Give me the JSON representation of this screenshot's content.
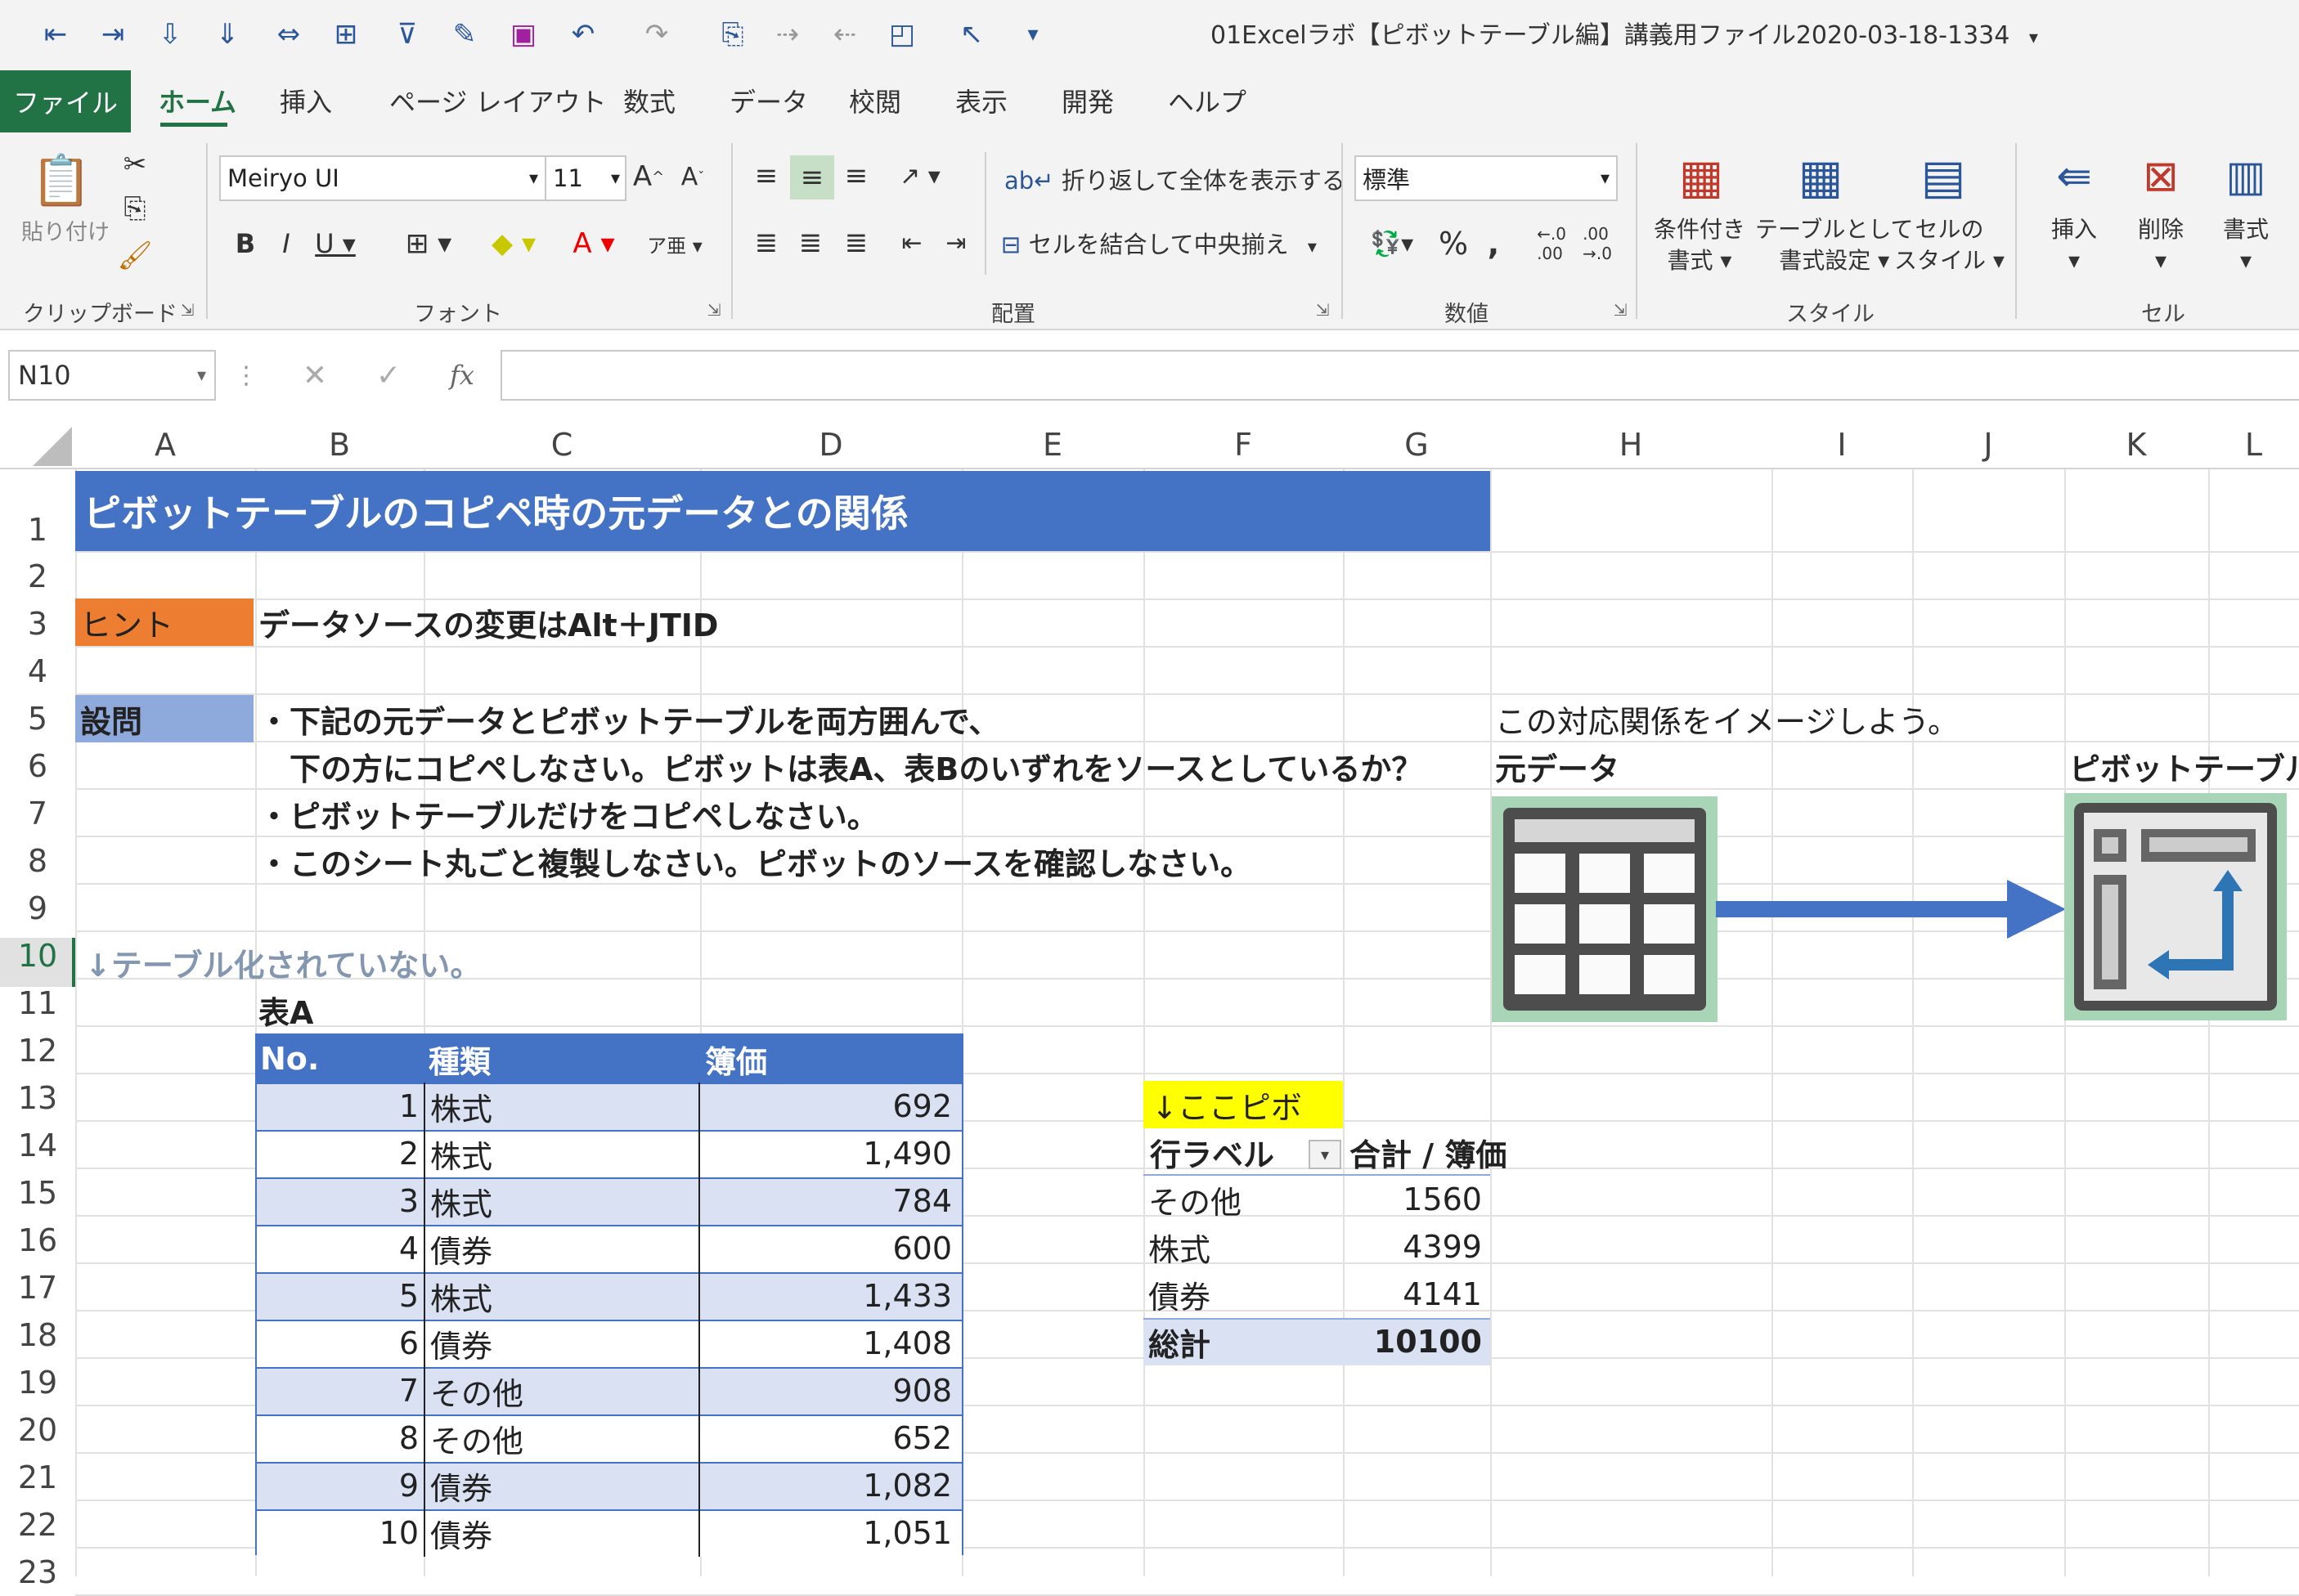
{
  "window": {
    "title": "01Excelラボ【ピボットテーブル編】講義用ファイル2020-03-18-1334",
    "title_dropdown": "▾"
  },
  "ribbon": {
    "tabs": [
      "ファイル",
      "ホーム",
      "挿入",
      "ページ レイアウト",
      "数式",
      "データ",
      "校閲",
      "表示",
      "開発",
      "ヘルプ"
    ],
    "clipboard": {
      "paste_label": "貼り付け",
      "group": "クリップボード"
    },
    "font": {
      "family": "Meiryo UI",
      "size": "11",
      "group": "フォント"
    },
    "alignment": {
      "wrap": "折り返して全体を表示する",
      "merge": "セルを結合して中央揃え",
      "group": "配置"
    },
    "number": {
      "format": "標準",
      "group": "数値"
    },
    "styles": {
      "cond_line1": "条件付き",
      "cond_line2": "書式",
      "table_line1": "テーブルとして",
      "table_line2": "書式設定",
      "cell_line1": "セルの",
      "cell_line2": "スタイル",
      "group": "スタイル"
    },
    "cells": {
      "insert": "挿入",
      "delete": "削除",
      "format": "書式",
      "group": "セル"
    }
  },
  "formula_bar": {
    "name_box": "N10",
    "fx": "fx",
    "value": ""
  },
  "columns": [
    "A",
    "B",
    "C",
    "D",
    "E",
    "F",
    "G",
    "H",
    "I",
    "J",
    "K",
    "L"
  ],
  "rows": [
    "1",
    "2",
    "3",
    "4",
    "5",
    "6",
    "7",
    "8",
    "9",
    "10",
    "11",
    "12",
    "13",
    "14",
    "15",
    "16",
    "17",
    "18",
    "19",
    "20",
    "21",
    "22",
    "23"
  ],
  "sheet": {
    "title": "ピボットテーブルのコピペ時の元データとの関係",
    "hint_label": "ヒント",
    "hint_text": "データソースの変更はAlt＋JTID",
    "q_label": "設問",
    "q1": "・下記の元データとピボットテーブルを両方囲んで、",
    "q1b": "　下の方にコピペしなさい。ピボットは表A、表Bのいずれをソースとしているか？",
    "q2": "・ピボットテーブルだけをコピペしなさい。",
    "q3": "・このシート丸ごと複製しなさい。ピボットのソースを確認しなさい。",
    "note": "↓テーブル化されていない。",
    "image_caption": "この対応関係をイメージしよう。",
    "source_label": "元データ",
    "pivot_label": "ピボットテーブル"
  },
  "table_a": {
    "name": "表A",
    "headers": [
      "No.",
      "種類",
      "簿価"
    ],
    "rows": [
      [
        "1",
        "株式",
        "692"
      ],
      [
        "2",
        "株式",
        "1,490"
      ],
      [
        "3",
        "株式",
        "784"
      ],
      [
        "4",
        "債券",
        "600"
      ],
      [
        "5",
        "株式",
        "1,433"
      ],
      [
        "6",
        "債券",
        "1,408"
      ],
      [
        "7",
        "その他",
        "908"
      ],
      [
        "8",
        "その他",
        "652"
      ],
      [
        "9",
        "債券",
        "1,082"
      ],
      [
        "10",
        "債券",
        "1,051"
      ]
    ]
  },
  "pivot": {
    "marker": "↓ここピボ",
    "row_label": "行ラベル",
    "value_header": "合計 / 簿価",
    "rows": [
      [
        "その他",
        "1560"
      ],
      [
        "株式",
        "4399"
      ],
      [
        "債券",
        "4141"
      ]
    ],
    "total_label": "総計",
    "total_value": "10100"
  },
  "colors": {
    "excel_green": "#217346",
    "title_blue": "#4472c4",
    "hint_orange": "#ed7d31",
    "q_blue": "#8ea9db",
    "band": "#d9e1f2",
    "yellow": "#ffff00"
  }
}
